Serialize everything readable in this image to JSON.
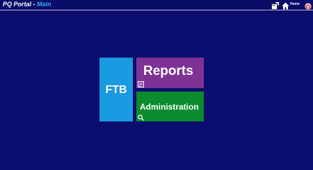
{
  "header": {
    "app_name": "PQ Portal",
    "separator": " - ",
    "page_name": "Main",
    "icons": {
      "new_window": "new-window-icon",
      "home": "home-icon",
      "power": "power-icon"
    },
    "home_label": "Home"
  },
  "tiles": {
    "ftb": {
      "label": "FTB",
      "color": "#1a9ae0"
    },
    "reports": {
      "label": "Reports",
      "color": "#7e3296",
      "icon": "report-icon"
    },
    "administration": {
      "label": "Administration",
      "color": "#0a8b2c",
      "icon": "search-icon"
    }
  },
  "colors": {
    "background": "#0b0e6e",
    "title_accent": "#3aa9ff"
  }
}
